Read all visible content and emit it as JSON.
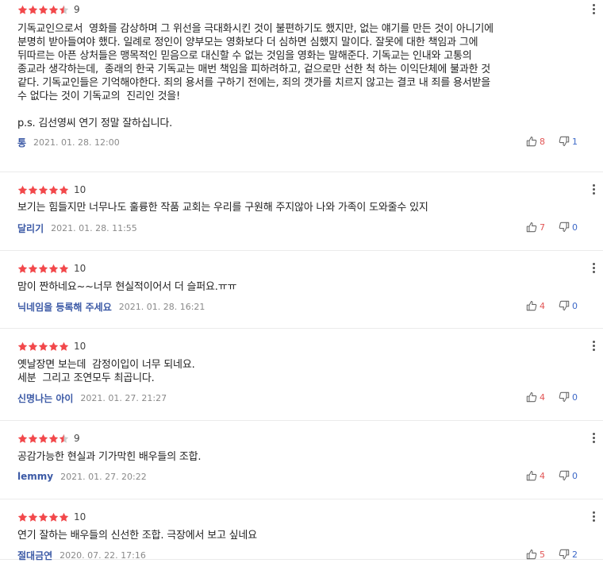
{
  "colors": {
    "star": "#f2484b",
    "nickname": "#3c5aa6",
    "like": "#e25555",
    "dislike": "#3c68c8"
  },
  "icons": {
    "more": "vertical-ellipsis-icon",
    "like": "thumbs-up-icon",
    "dislike": "thumbs-down-icon",
    "star": "star-icon"
  },
  "reviews": [
    {
      "rating": 9,
      "score": "9",
      "text": "기독교인으로서  영화를 감상하며 그 위선을 극대화시킨 것이 불편하기도 했지만, 없는 얘기를 만든 것이 아니기에\n분명히 받아들여야 했다. 일례로 정인이 양부모는 영화보다 더 심하면 심했지 말이다. 잘못에 대한 책임과 그에\n뒤따르는 아픈 상처들은 맹목적인 믿음으로 대신할 수 없는 것임을 영화는 말해준다. 기독교는 인내와 고통의\n종교라 생각하는데,  종래의 한국 기독교는 매번 책임을 피하려하고, 겉으로만 선한 척 하는 이익단체에 불과한 것\n같다. 기독교인들은 기억해야한다. 죄의 용서를 구하기 전에는, 죄의 갯가를 치르지 않고는 결코 내 죄를 용서받을\n수 없다는 것이 기독교의  진리인 것을!\n\np.s. 김선영씨 연기 정말 잘하십니다.",
      "nickname": "통",
      "date": "2021. 01. 28. 12:00",
      "likes": "8",
      "dislikes": "1"
    },
    {
      "rating": 10,
      "score": "10",
      "text": "보기는 힘들지만 너무나도 훌륭한 작품 교회는 우리를 구원해 주지않아 나와 가족이 도와줄수 있지",
      "nickname": "달리기",
      "date": "2021. 01. 28. 11:55",
      "likes": "7",
      "dislikes": "0"
    },
    {
      "rating": 10,
      "score": "10",
      "text": "맘이 짠하네요~~너무 현실적이어서 더 슬퍼요.ㅠㅠ",
      "nickname": "닉네임을 등록해 주세요",
      "date": "2021. 01. 28. 16:21",
      "likes": "4",
      "dislikes": "0"
    },
    {
      "rating": 10,
      "score": "10",
      "text": "옛날장면 보는데  감정이입이 너무 되네요.\n세분  그리고 조연모두 최곱니다.",
      "nickname": "신명나는 아이",
      "date": "2021. 01. 27. 21:27",
      "likes": "4",
      "dislikes": "0"
    },
    {
      "rating": 9,
      "score": "9",
      "text": "공감가능한 현실과 기가막힌 배우들의 조합.",
      "nickname": "lemmy",
      "date": "2021. 01. 27. 20:22",
      "likes": "4",
      "dislikes": "0"
    },
    {
      "rating": 10,
      "score": "10",
      "text": "연기 잘하는 배우들의 신선한 조합. 극장에서 보고 싶네요",
      "nickname": "절대금연",
      "date": "2020. 07. 22. 17:16",
      "likes": "5",
      "dislikes": "2"
    }
  ]
}
